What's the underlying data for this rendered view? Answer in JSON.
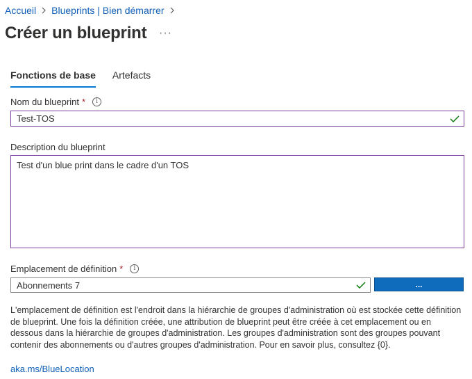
{
  "breadcrumb": {
    "items": [
      "Accueil",
      "Blueprints | Bien démarrer"
    ],
    "separator": ">"
  },
  "page": {
    "title": "Créer un blueprint",
    "more": "···"
  },
  "tabs": [
    {
      "label": "Fonctions de base",
      "active": true
    },
    {
      "label": "Artefacts",
      "active": false
    }
  ],
  "form": {
    "name": {
      "label": "Nom du blueprint",
      "required_marker": "*",
      "info": "i",
      "value": "Test-TOS"
    },
    "description": {
      "label": "Description du blueprint",
      "value": "Test d'un blue print dans le cadre d'un TOS"
    },
    "location": {
      "label": "Emplacement de définition",
      "required_marker": "*",
      "info": "i",
      "value": "Abonnements 7",
      "browse_label": "..."
    }
  },
  "help": {
    "text": "L'emplacement de définition est l'endroit dans la hiérarchie de groupes d'administration où est stockée cette définition de blueprint. Une fois la définition créée, une attribution de blueprint peut être créée à cet emplacement ou en dessous dans la hiérarchie de groupes d'administration. Les groupes d'administration sont des groupes pouvant contenir des abonnements ou d'autres groupes d'administration. Pour en savoir plus, consultez {0}.",
    "link": "aka.ms/BlueLocation"
  },
  "colors": {
    "link": "#0f5fb8",
    "accent": "#0078d4",
    "required": "#a4262c",
    "valid": "#107c10",
    "focus_border": "#7e3f9d"
  }
}
